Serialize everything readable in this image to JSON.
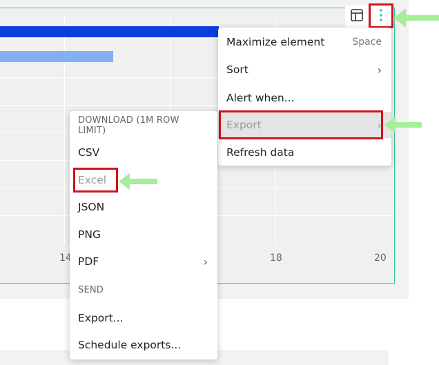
{
  "chart": {
    "bar1_fraction": 1.0,
    "bar2_fraction": 0.29,
    "x_tick_labels": [
      "14",
      "18",
      "20"
    ],
    "bar_colors": [
      "#0a3fdb",
      "#82b0f6"
    ],
    "frame_color": "#35c6a2"
  },
  "toolbar": {
    "table_icon": "table-icon",
    "more_icon": "vertical-ellipsis-icon"
  },
  "element_menu": {
    "items": [
      {
        "label": "Maximize element",
        "shortcut": "Space"
      },
      {
        "label": "Sort",
        "submenu": true
      },
      {
        "label": "Alert when..."
      },
      {
        "label": "Export",
        "submenu": true,
        "state": "highlighted"
      },
      {
        "label": "Refresh data"
      }
    ]
  },
  "export_menu": {
    "download_header": "DOWNLOAD (1M ROW LIMIT)",
    "download_items": [
      {
        "label": "CSV"
      },
      {
        "label": "Excel",
        "state": "highlighted"
      },
      {
        "label": "JSON"
      },
      {
        "label": "PNG"
      },
      {
        "label": "PDF",
        "submenu": true
      }
    ],
    "send_header": "SEND",
    "send_items": [
      {
        "label": "Export..."
      },
      {
        "label": "Schedule exports..."
      }
    ]
  },
  "annotations": {
    "highlight_color": "#d0121b",
    "arrow_color": "#a6ee9a"
  }
}
